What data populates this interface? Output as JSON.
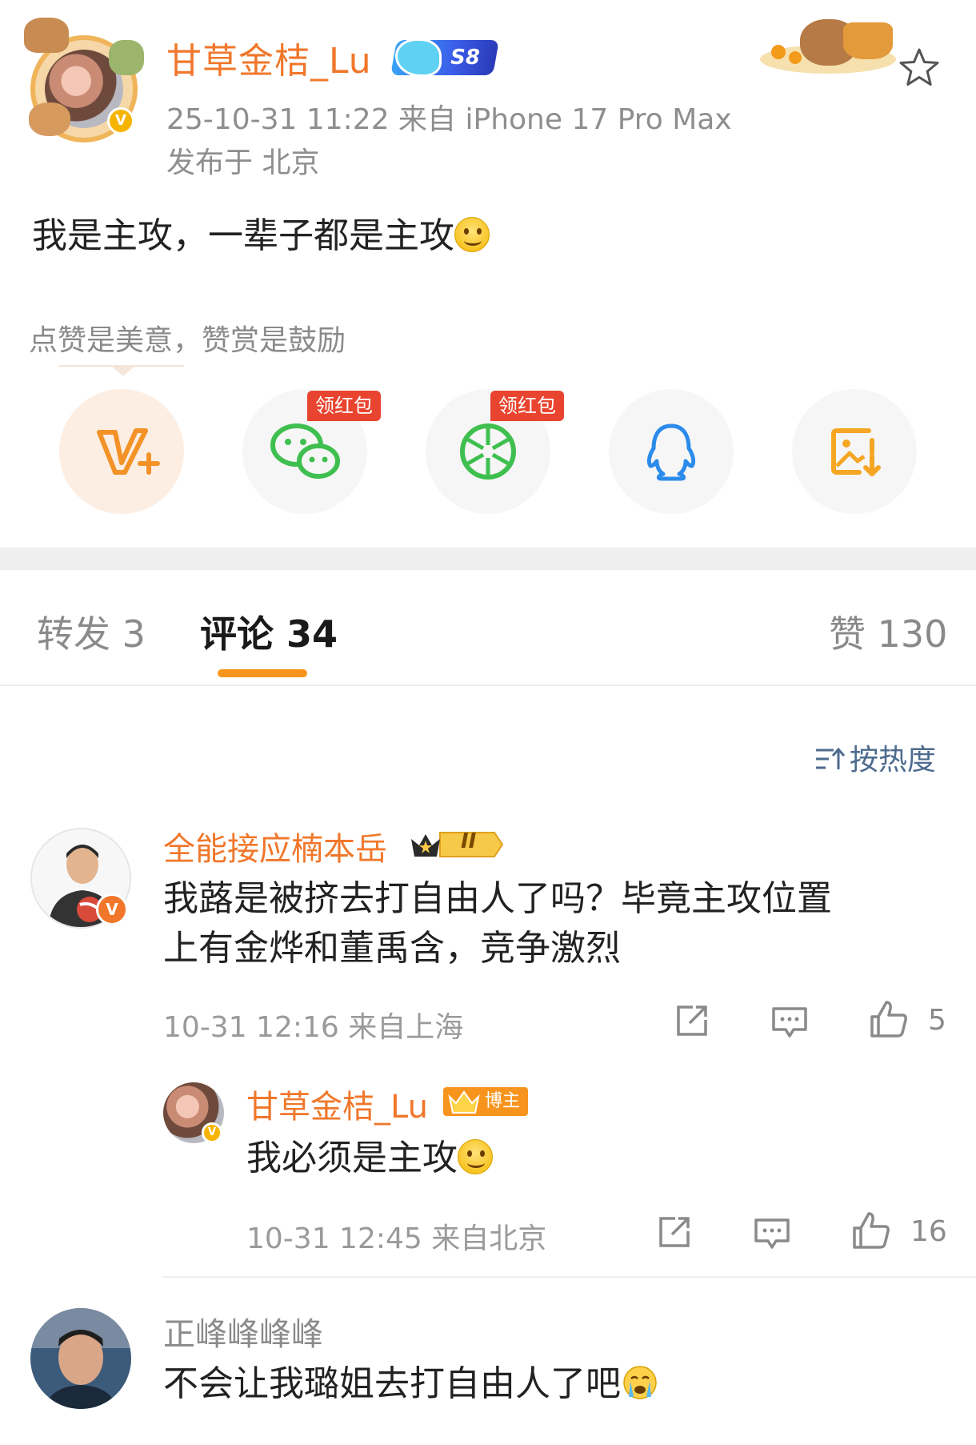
{
  "post": {
    "author_name": "甘草金桔_Lu",
    "level_badge": "S8",
    "verified_mark": "V",
    "time_source": "25-10-31 11:22  来自 iPhone 17 Pro Max",
    "location": "发布于 北京",
    "text": "我是主攻，一辈子都是主攻",
    "text_emoji": "smile-emoji"
  },
  "reward": {
    "hint": "点赞是美意，赞赏是鼓励"
  },
  "share": {
    "items": [
      {
        "icon": "v-plus-icon",
        "tag": ""
      },
      {
        "icon": "wechat-icon",
        "tag": "领红包"
      },
      {
        "icon": "moments-icon",
        "tag": "领红包"
      },
      {
        "icon": "qq-icon",
        "tag": ""
      },
      {
        "icon": "save-image-icon",
        "tag": ""
      }
    ]
  },
  "tabs": {
    "repost": "转发 3",
    "comments": "评论 34",
    "likes": "赞 130"
  },
  "sort": {
    "label": "按热度",
    "icon": "sort-icon"
  },
  "comments": [
    {
      "name": "全能接应楠本岳",
      "badge": "II",
      "text_line1": "我蕗是被挤去打自由人了吗？毕竟主攻位置",
      "text_line2": "上有金烨和董禹含，竞争激烈",
      "meta": "10-31 12:16  来自上海",
      "likes": "5",
      "reply": {
        "name": "甘草金桔_Lu",
        "badge": "博主",
        "text": "我必须是主攻",
        "meta": "10-31 12:45  来自北京",
        "likes": "16"
      }
    },
    {
      "name": "正峰峰峰峰",
      "text": "不会让我璐姐去打自由人了吧"
    }
  ],
  "colors": {
    "accent_orange": "#f0772b",
    "tab_indicator": "#f7941d",
    "red_tag": "#e8442f",
    "wechat_green": "#3fbf4f",
    "qq_blue": "#2b8bea",
    "save_orange": "#f5a623",
    "sort_blue": "#4d6b8e"
  }
}
